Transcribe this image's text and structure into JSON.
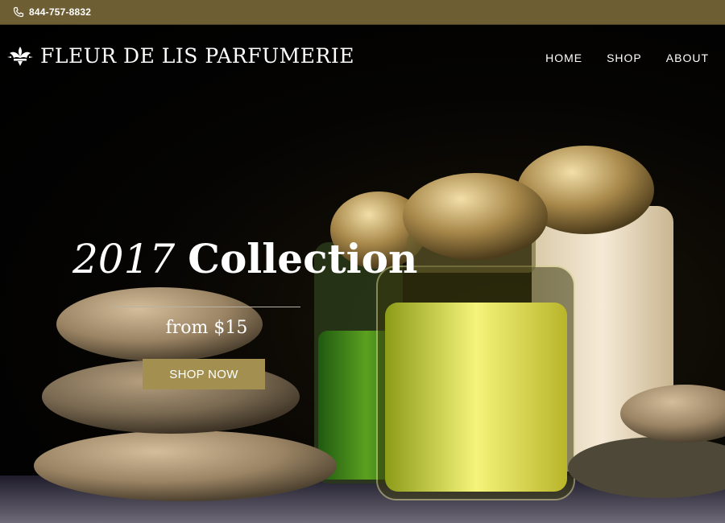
{
  "topbar": {
    "phone": "844-757-8832",
    "icon": "phone-icon"
  },
  "brand": {
    "name": "FLEUR DE LIS PARFUMERIE",
    "icon": "fleur-de-lis-icon"
  },
  "nav": {
    "items": [
      "HOME",
      "SHOP",
      "ABOUT"
    ]
  },
  "hero": {
    "year": "2017",
    "title_word": "Collection",
    "subtitle": "from $15",
    "cta_label": "SHOP NOW"
  },
  "colors": {
    "topbar": "#6d5e34",
    "accent": "#a39050",
    "background": "#000000"
  }
}
